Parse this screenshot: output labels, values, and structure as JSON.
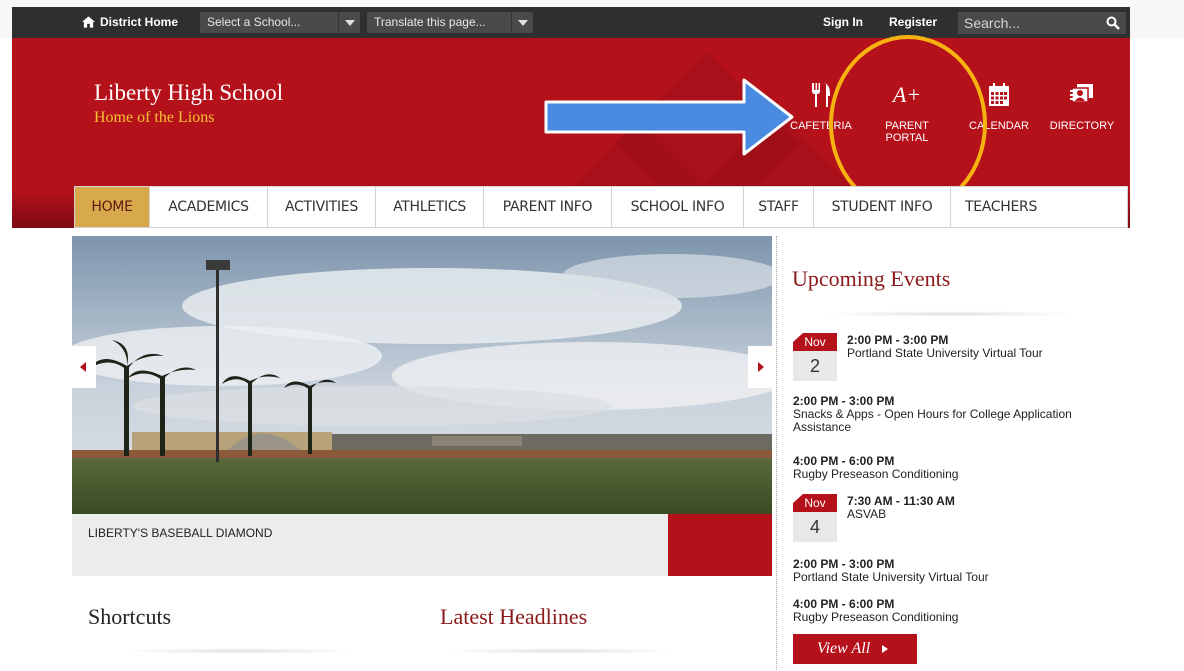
{
  "topbar": {
    "district_home": "District Home",
    "select_school": "Select a School...",
    "translate": "Translate this page...",
    "sign_in": "Sign In",
    "register": "Register",
    "search_placeholder": "Search..."
  },
  "header": {
    "school_name": "Liberty High School",
    "tagline": "Home of the Lions",
    "quick_links": [
      {
        "label": "CAFETERIA",
        "icon": "fork-knife-icon"
      },
      {
        "label": "PARENT\nPORTAL",
        "icon": "a-plus-icon"
      },
      {
        "label": "CALENDAR",
        "icon": "calendar-icon"
      },
      {
        "label": "DIRECTORY",
        "icon": "directory-icon"
      }
    ],
    "a_plus_glyph": "A+"
  },
  "nav": {
    "items": [
      "HOME",
      "ACADEMICS",
      "ACTIVITIES",
      "ATHLETICS",
      "PARENT INFO",
      "SCHOOL INFO",
      "STAFF",
      "STUDENT INFO",
      "TEACHERS"
    ],
    "active": "HOME"
  },
  "slideshow": {
    "caption": "LIBERTY'S BASEBALL DIAMOND"
  },
  "sections": {
    "shortcuts": "Shortcuts",
    "headlines": "Latest Headlines",
    "events": "Upcoming Events"
  },
  "events": [
    {
      "month": "Nov",
      "day": "2",
      "time": "2:00 PM - 3:00 PM",
      "title": "Portland State University Virtual Tour"
    },
    {
      "time": "2:00 PM - 3:00 PM",
      "title": "Snacks & Apps - Open Hours for College Application Assistance"
    },
    {
      "time": "4:00 PM - 6:00 PM",
      "title": "Rugby Preseason Conditioning"
    },
    {
      "month": "Nov",
      "day": "4",
      "time": "7:30 AM - 11:30 AM",
      "title": "ASVAB"
    },
    {
      "time": "2:00 PM - 3:00 PM",
      "title": "Portland State University Virtual Tour"
    },
    {
      "time": "4:00 PM - 6:00 PM",
      "title": "Rugby Preseason Conditioning"
    }
  ],
  "view_all": "View All",
  "colors": {
    "brand_red": "#b5111b",
    "gold": "#f1c232",
    "nav_active": "#d8a84c",
    "annotation_blue": "#4a8ae0",
    "annotation_orange": "#f6b310"
  }
}
